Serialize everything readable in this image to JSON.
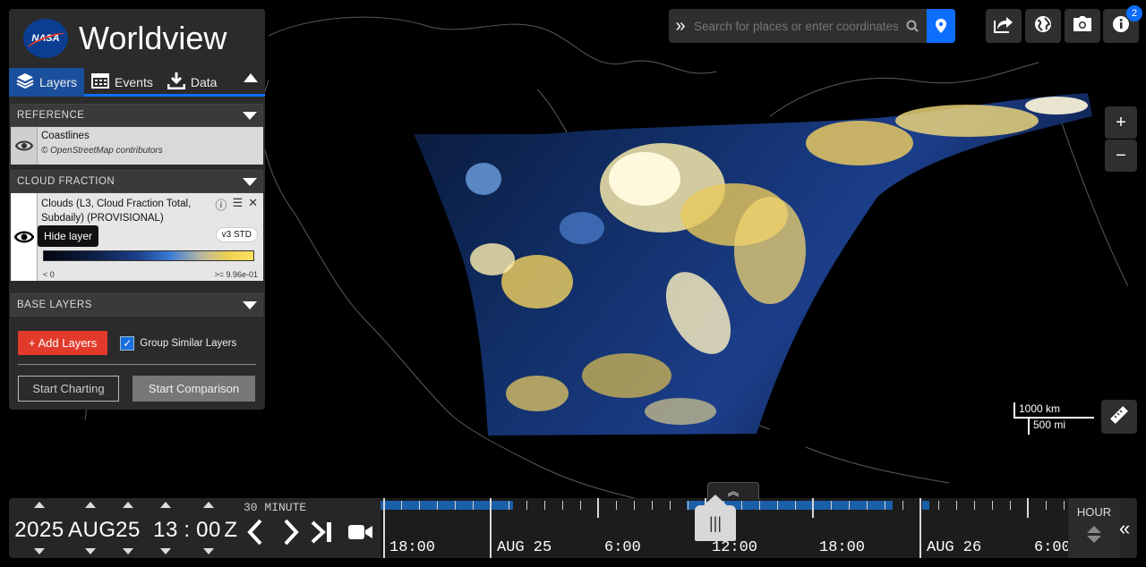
{
  "app": {
    "title": "Worldview",
    "logo": "NASA"
  },
  "tabs": [
    {
      "label": "Layers",
      "icon": "layers-icon"
    },
    {
      "label": "Events",
      "icon": "calendar-icon"
    },
    {
      "label": "Data",
      "icon": "download-icon"
    }
  ],
  "groups": {
    "reference": "REFERENCE",
    "cloud_fraction": "CLOUD FRACTION",
    "base_layers": "BASE LAYERS"
  },
  "layers": {
    "coastlines": {
      "name": "Coastlines",
      "attribution": "© OpenStreetMap contributors"
    },
    "clouds": {
      "name": "Clouds (L3, Cloud Fraction Total, Subdaily) (PROVISIONAL)",
      "badge": "v3 STD",
      "legend_min": "< 0",
      "legend_max": ">= 9.96e-01"
    }
  },
  "tooltip": "Hide layer",
  "buttons": {
    "add_layers": "+ Add Layers",
    "group_similar": "Group Similar Layers",
    "start_charting": "Start Charting",
    "start_comparison": "Start Comparison"
  },
  "search": {
    "placeholder": "Search for places or enter coordinates"
  },
  "notifications_count": "2",
  "scale": {
    "km": "1000 km",
    "mi": "500 mi"
  },
  "date": {
    "year": "2025",
    "month": "AUG",
    "day": "25",
    "hour": "13",
    "separator": ":",
    "minute": "00",
    "zone": "Z"
  },
  "timeline": {
    "interval": "30 MINUTE",
    "zoom_level": "HOUR",
    "labels": [
      "18:00",
      "AUG 25",
      "6:00",
      "12:00",
      "18:00",
      "AUG 26",
      "6:00"
    ]
  },
  "colors": {
    "accent": "#0d6efd",
    "add_button": "#e13a2a"
  }
}
